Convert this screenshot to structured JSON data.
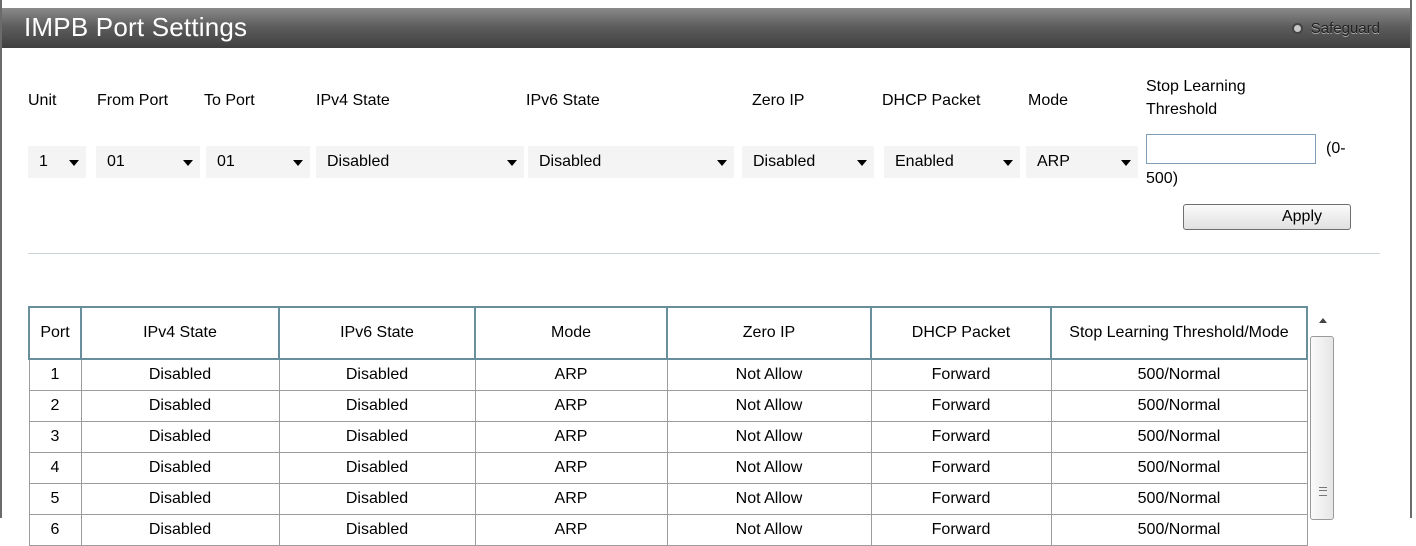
{
  "window": {
    "title": "IMPB Port Settings",
    "safeguard": "Safeguard"
  },
  "form": {
    "labels": {
      "unit": "Unit",
      "from_port": "From Port",
      "to_port": "To Port",
      "ipv4_state": "IPv4 State",
      "ipv6_state": "IPv6 State",
      "zero_ip": "Zero IP",
      "dhcp_packet": "DHCP Packet",
      "mode": "Mode",
      "stop_learning_1": "Stop Learning",
      "stop_learning_2": "Threshold"
    },
    "values": {
      "unit": "1",
      "from_port": "01",
      "to_port": "01",
      "ipv4_state": "Disabled",
      "ipv6_state": "Disabled",
      "zero_ip": "Disabled",
      "dhcp_packet": "Enabled",
      "mode": "ARP",
      "threshold": ""
    },
    "range_1": "(0-",
    "range_2": "500)",
    "apply_label": "Apply"
  },
  "table": {
    "headers": [
      "Port",
      "IPv4 State",
      "IPv6 State",
      "Mode",
      "Zero IP",
      "DHCP Packet",
      "Stop Learning Threshold/Mode"
    ],
    "rows": [
      [
        "1",
        "Disabled",
        "Disabled",
        "ARP",
        "Not Allow",
        "Forward",
        "500/Normal"
      ],
      [
        "2",
        "Disabled",
        "Disabled",
        "ARP",
        "Not Allow",
        "Forward",
        "500/Normal"
      ],
      [
        "3",
        "Disabled",
        "Disabled",
        "ARP",
        "Not Allow",
        "Forward",
        "500/Normal"
      ],
      [
        "4",
        "Disabled",
        "Disabled",
        "ARP",
        "Not Allow",
        "Forward",
        "500/Normal"
      ],
      [
        "5",
        "Disabled",
        "Disabled",
        "ARP",
        "Not Allow",
        "Forward",
        "500/Normal"
      ],
      [
        "6",
        "Disabled",
        "Disabled",
        "ARP",
        "Not Allow",
        "Forward",
        "500/Normal"
      ]
    ]
  },
  "colors": {
    "titlebar": "#5e5e5e",
    "table_header_border": "#6a8f9c"
  },
  "icons": {
    "safeguard": "radio-circle-icon",
    "scroll_up": "arrow-up-icon",
    "scroll_grip": "grip-icon"
  }
}
